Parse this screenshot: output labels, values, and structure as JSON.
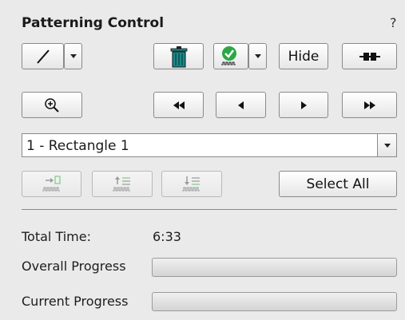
{
  "panel": {
    "title": "Patterning Control",
    "help": "?"
  },
  "toolbar": {
    "line_tool": "line-icon",
    "delete": "trash-icon",
    "validate": "check-icon",
    "hide_label": "Hide",
    "connect": "connect-icon"
  },
  "nav": {
    "zoom": "zoom-in-icon",
    "first": "◀◀",
    "prev": "◀",
    "next": "▶",
    "last": "▶▶"
  },
  "pattern_select": {
    "value": "1 - Rectangle 1"
  },
  "actions": {
    "select_all_label": "Select All"
  },
  "stats": {
    "total_time_label": "Total Time:",
    "total_time_value": "6:33",
    "overall_progress_label": "Overall Progress",
    "overall_progress": 0,
    "current_progress_label": "Current Progress",
    "current_progress": 0
  },
  "colors": {
    "accent_green": "#2aa845",
    "trash_teal": "#1a8a8a"
  }
}
